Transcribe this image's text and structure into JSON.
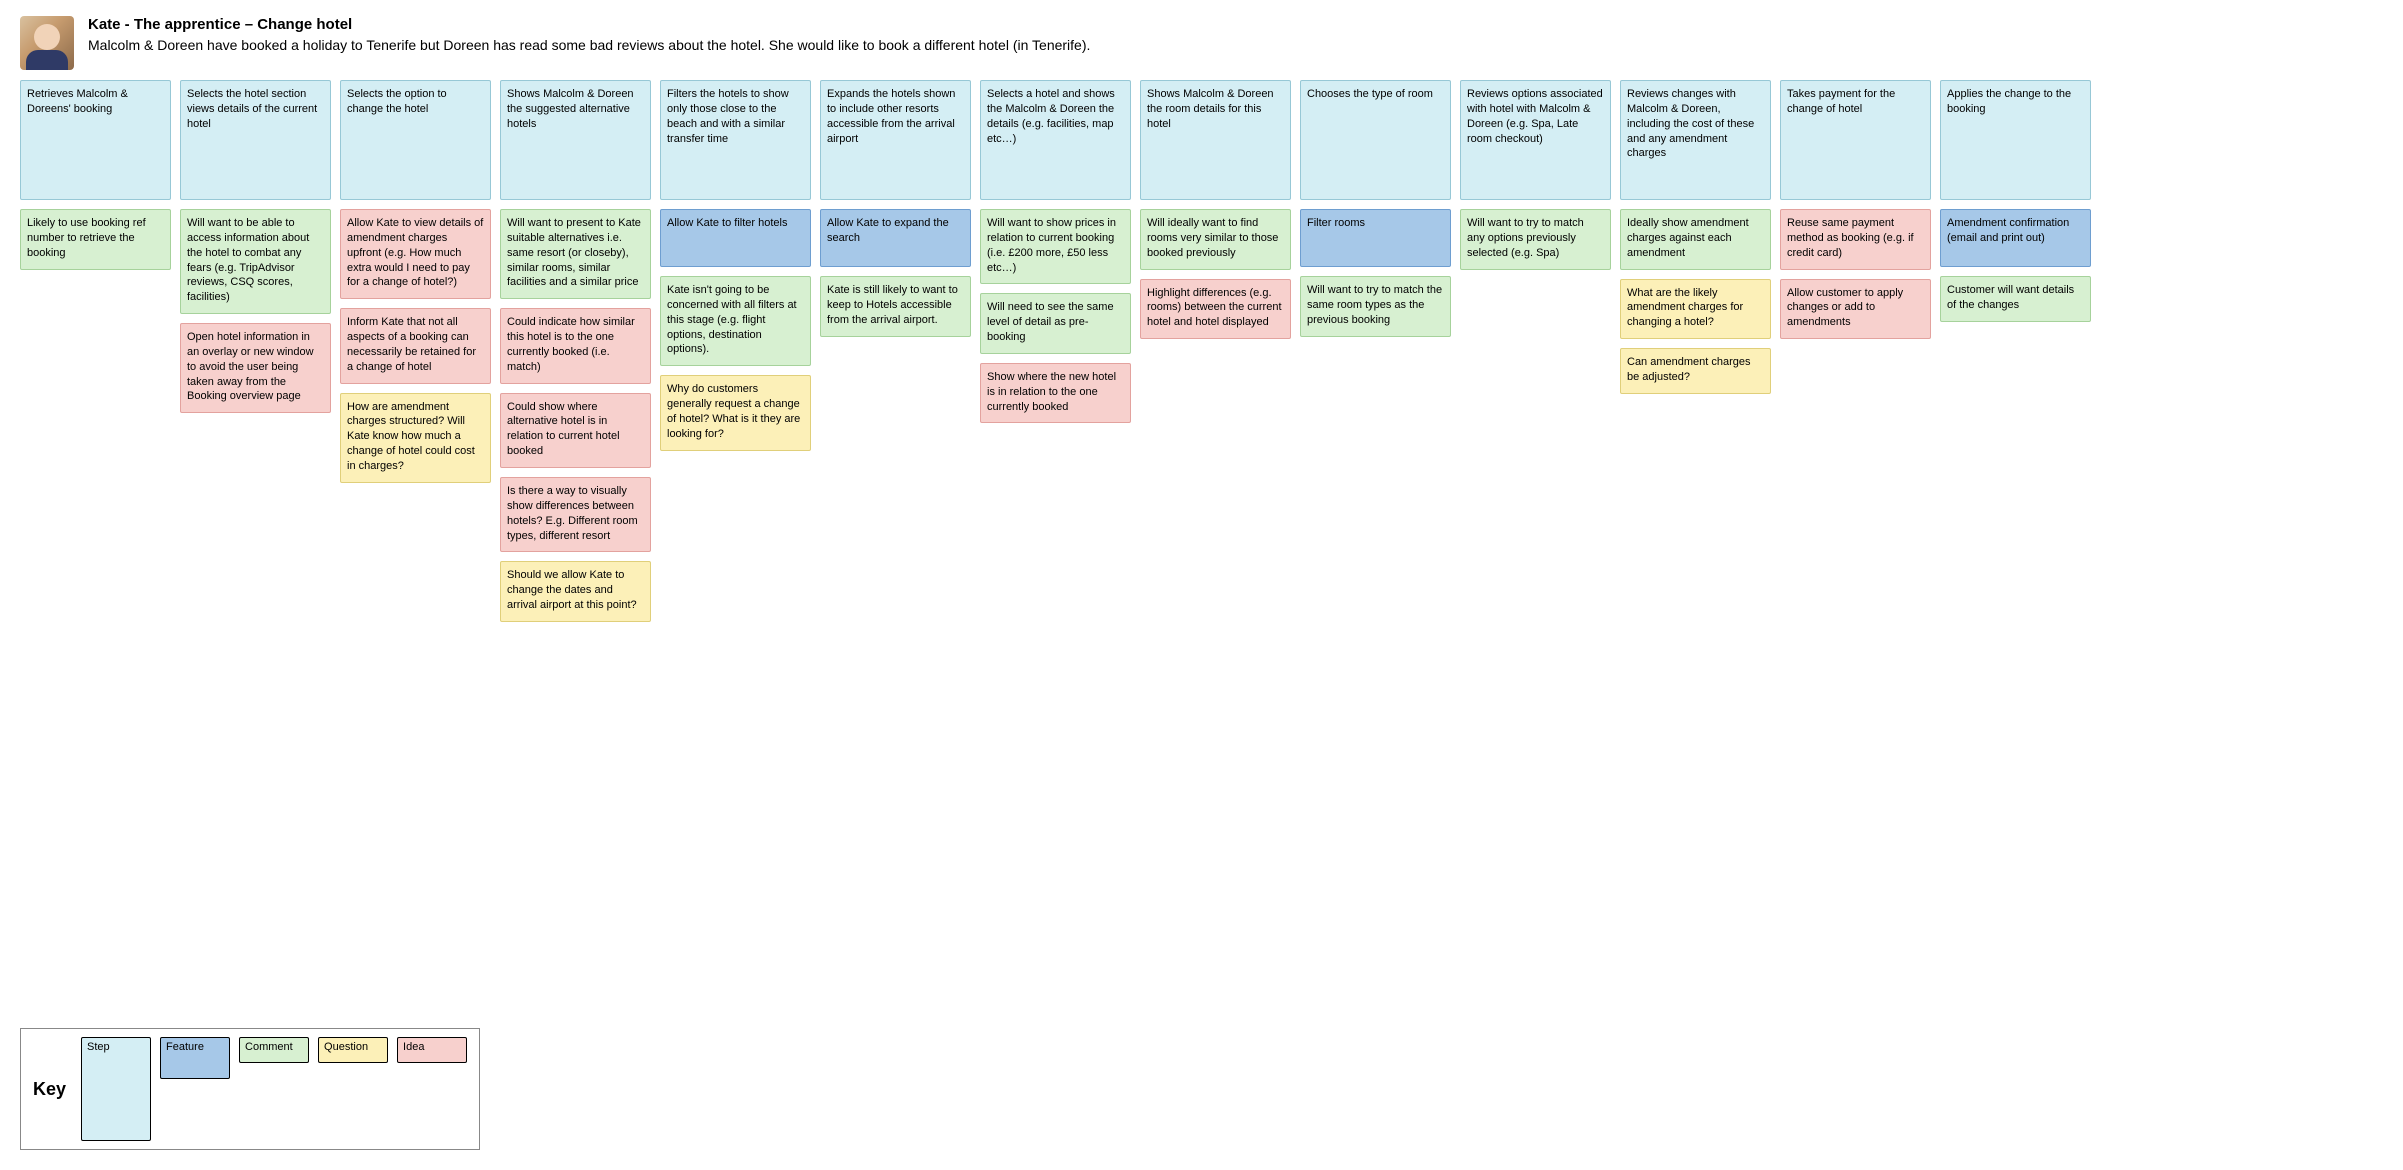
{
  "header": {
    "title": "Kate - The apprentice – Change hotel",
    "subtitle": "Malcolm & Doreen have booked a holiday to Tenerife but Doreen has read some bad reviews about the hotel. She would like to book a different hotel (in Tenerife)."
  },
  "key": {
    "label": "Key",
    "items": [
      {
        "type": "step",
        "label": "Step"
      },
      {
        "type": "feature",
        "label": "Feature"
      },
      {
        "type": "comment",
        "label": "Comment"
      },
      {
        "type": "question",
        "label": "Question"
      },
      {
        "type": "idea",
        "label": "Idea"
      }
    ]
  },
  "columns": [
    {
      "cards": [
        {
          "type": "step",
          "text": "Retrieves Malcolm & Doreens' booking"
        },
        {
          "type": "comment",
          "text": "Likely to use booking ref number to retrieve the booking"
        }
      ]
    },
    {
      "cards": [
        {
          "type": "step",
          "text": "Selects the hotel section views details of the current hotel"
        },
        {
          "type": "comment",
          "text": "Will want to be able to access information about the hotel to combat any fears (e.g. TripAdvisor reviews, CSQ scores, facilities)"
        },
        {
          "type": "idea",
          "text": "Open hotel information in an overlay or new window to avoid the user being taken away from the Booking overview page"
        }
      ]
    },
    {
      "cards": [
        {
          "type": "step",
          "text": "Selects the option to change the hotel"
        },
        {
          "type": "idea",
          "text": "Allow Kate to view details of amendment charges upfront (e.g. How much extra would I need to pay for a change of hotel?)"
        },
        {
          "type": "idea",
          "text": "Inform Kate that not all aspects of a booking can necessarily be retained for a change of hotel"
        },
        {
          "type": "question",
          "text": "How are amendment charges structured? Will Kate know how much a change of hotel could cost in charges?"
        }
      ]
    },
    {
      "cards": [
        {
          "type": "step",
          "text": "Shows Malcolm & Doreen the suggested alternative hotels"
        },
        {
          "type": "comment",
          "text": "Will want to present to Kate suitable alternatives i.e. same resort (or closeby), similar rooms, similar facilities and a similar price"
        },
        {
          "type": "idea",
          "text": "Could indicate how similar this hotel is to the one currently booked (i.e. match)"
        },
        {
          "type": "idea",
          "text": "Could show where alternative hotel is in relation to current hotel booked"
        },
        {
          "type": "idea",
          "text": "Is there a way to visually show differences between hotels? E.g. Different room types, different resort"
        },
        {
          "type": "question",
          "text": "Should we allow Kate to change the dates and arrival airport at this point?"
        }
      ]
    },
    {
      "cards": [
        {
          "type": "step",
          "text": "Filters the hotels to show only those close to the beach and with a similar transfer time"
        },
        {
          "type": "feature",
          "text": "Allow Kate to filter hotels"
        },
        {
          "type": "comment",
          "text": "Kate isn't going to be concerned with all filters at this stage (e.g. flight options, destination options)."
        },
        {
          "type": "question",
          "text": "Why do customers generally request a change of hotel? What is it they are looking for?"
        }
      ]
    },
    {
      "cards": [
        {
          "type": "step",
          "text": "Expands the hotels shown to include other resorts accessible from the arrival airport"
        },
        {
          "type": "feature",
          "text": "Allow Kate to expand the search"
        },
        {
          "type": "comment",
          "text": "Kate is still likely to want to keep to Hotels accessible from the arrival airport."
        }
      ]
    },
    {
      "cards": [
        {
          "type": "step",
          "text": "Selects a hotel and shows the Malcolm & Doreen the details (e.g. facilities, map etc…)"
        },
        {
          "type": "comment",
          "text": "Will want to show prices in relation to current booking (i.e. £200 more, £50 less etc…)"
        },
        {
          "type": "comment",
          "text": "Will need to see the same level of detail as pre-booking"
        },
        {
          "type": "idea",
          "text": "Show where the new hotel is in relation to the one currently booked"
        }
      ]
    },
    {
      "cards": [
        {
          "type": "step",
          "text": "Shows Malcolm & Doreen the room details for this hotel"
        },
        {
          "type": "comment",
          "text": "Will ideally want to find rooms very similar to those booked previously"
        },
        {
          "type": "idea",
          "text": "Highlight differences (e.g. rooms) between the current hotel and hotel displayed"
        }
      ]
    },
    {
      "cards": [
        {
          "type": "step",
          "text": "Chooses the type of room"
        },
        {
          "type": "feature",
          "text": "Filter rooms"
        },
        {
          "type": "comment",
          "text": "Will want to try to match the same room types as the previous booking"
        }
      ]
    },
    {
      "cards": [
        {
          "type": "step",
          "text": "Reviews options associated with hotel with Malcolm & Doreen (e.g. Spa, Late room checkout)"
        },
        {
          "type": "comment",
          "text": "Will want to try to match any options previously selected (e.g. Spa)"
        }
      ]
    },
    {
      "cards": [
        {
          "type": "step",
          "text": "Reviews changes with Malcolm & Doreen, including the cost of these and any amendment charges"
        },
        {
          "type": "comment",
          "text": "Ideally show amendment charges against each amendment"
        },
        {
          "type": "question",
          "text": "What are the likely amendment charges for changing a hotel?"
        },
        {
          "type": "question",
          "text": "Can amendment charges be adjusted?"
        }
      ]
    },
    {
      "cards": [
        {
          "type": "step",
          "text": "Takes payment for the change of hotel"
        },
        {
          "type": "idea",
          "text": "Reuse same payment method as booking (e.g. if credit card)"
        },
        {
          "type": "idea",
          "text": "Allow customer to apply changes or add to amendments"
        }
      ]
    },
    {
      "cards": [
        {
          "type": "step",
          "text": "Applies the change to the booking"
        },
        {
          "type": "feature",
          "text": "Amendment confirmation (email and print out)"
        },
        {
          "type": "comment",
          "text": "Customer will want details of the changes"
        }
      ]
    }
  ]
}
